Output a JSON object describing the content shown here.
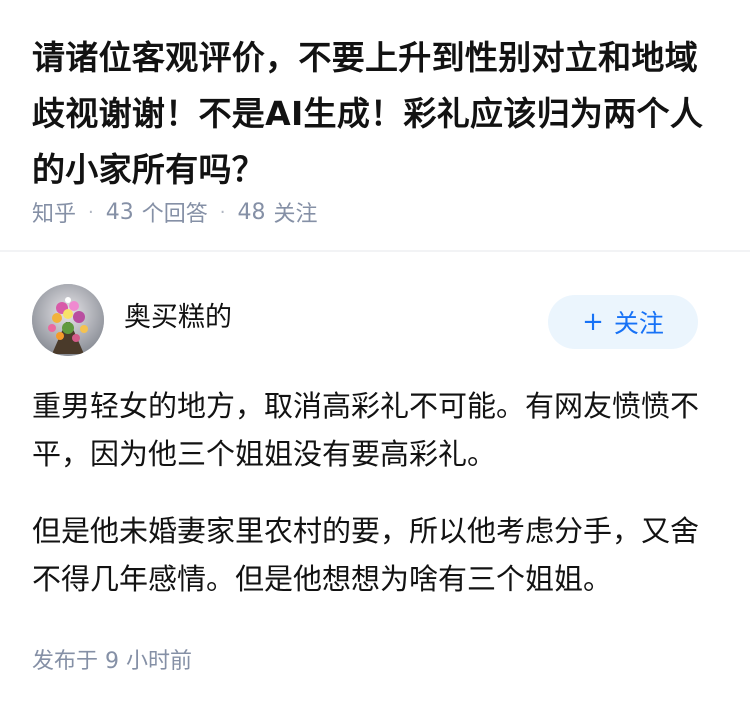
{
  "question": {
    "title": "请诸位客观评价，不要上升到性别对立和地域歧视谢谢！不是AI生成！彩礼应该归为两个人的小家所有吗？",
    "source": "知乎",
    "answers_count": "43",
    "answers_label": "个回答",
    "followers_count": "48",
    "followers_label": "关注"
  },
  "answer": {
    "author": {
      "name": "奥买糕的",
      "avatar_icon": "flower-bouquet-avatar"
    },
    "follow_button": {
      "icon": "plus-icon",
      "plus": "+",
      "label": "关注"
    },
    "paragraphs": [
      "重男轻女的地方，取消高彩礼不可能。有网友愤愤不平，因为他三个姐姐没有要高彩礼。",
      "但是他未婚妻家里农村的要，所以他考虑分手，又舍不得几年感情。但是他想想为啥有三个姐姐。"
    ],
    "published": "发布于 9 小时前"
  },
  "colors": {
    "accent": "#1772f6",
    "follow_bg": "#ebf5fd",
    "meta_text": "#8590a6",
    "title_text": "#121212"
  }
}
